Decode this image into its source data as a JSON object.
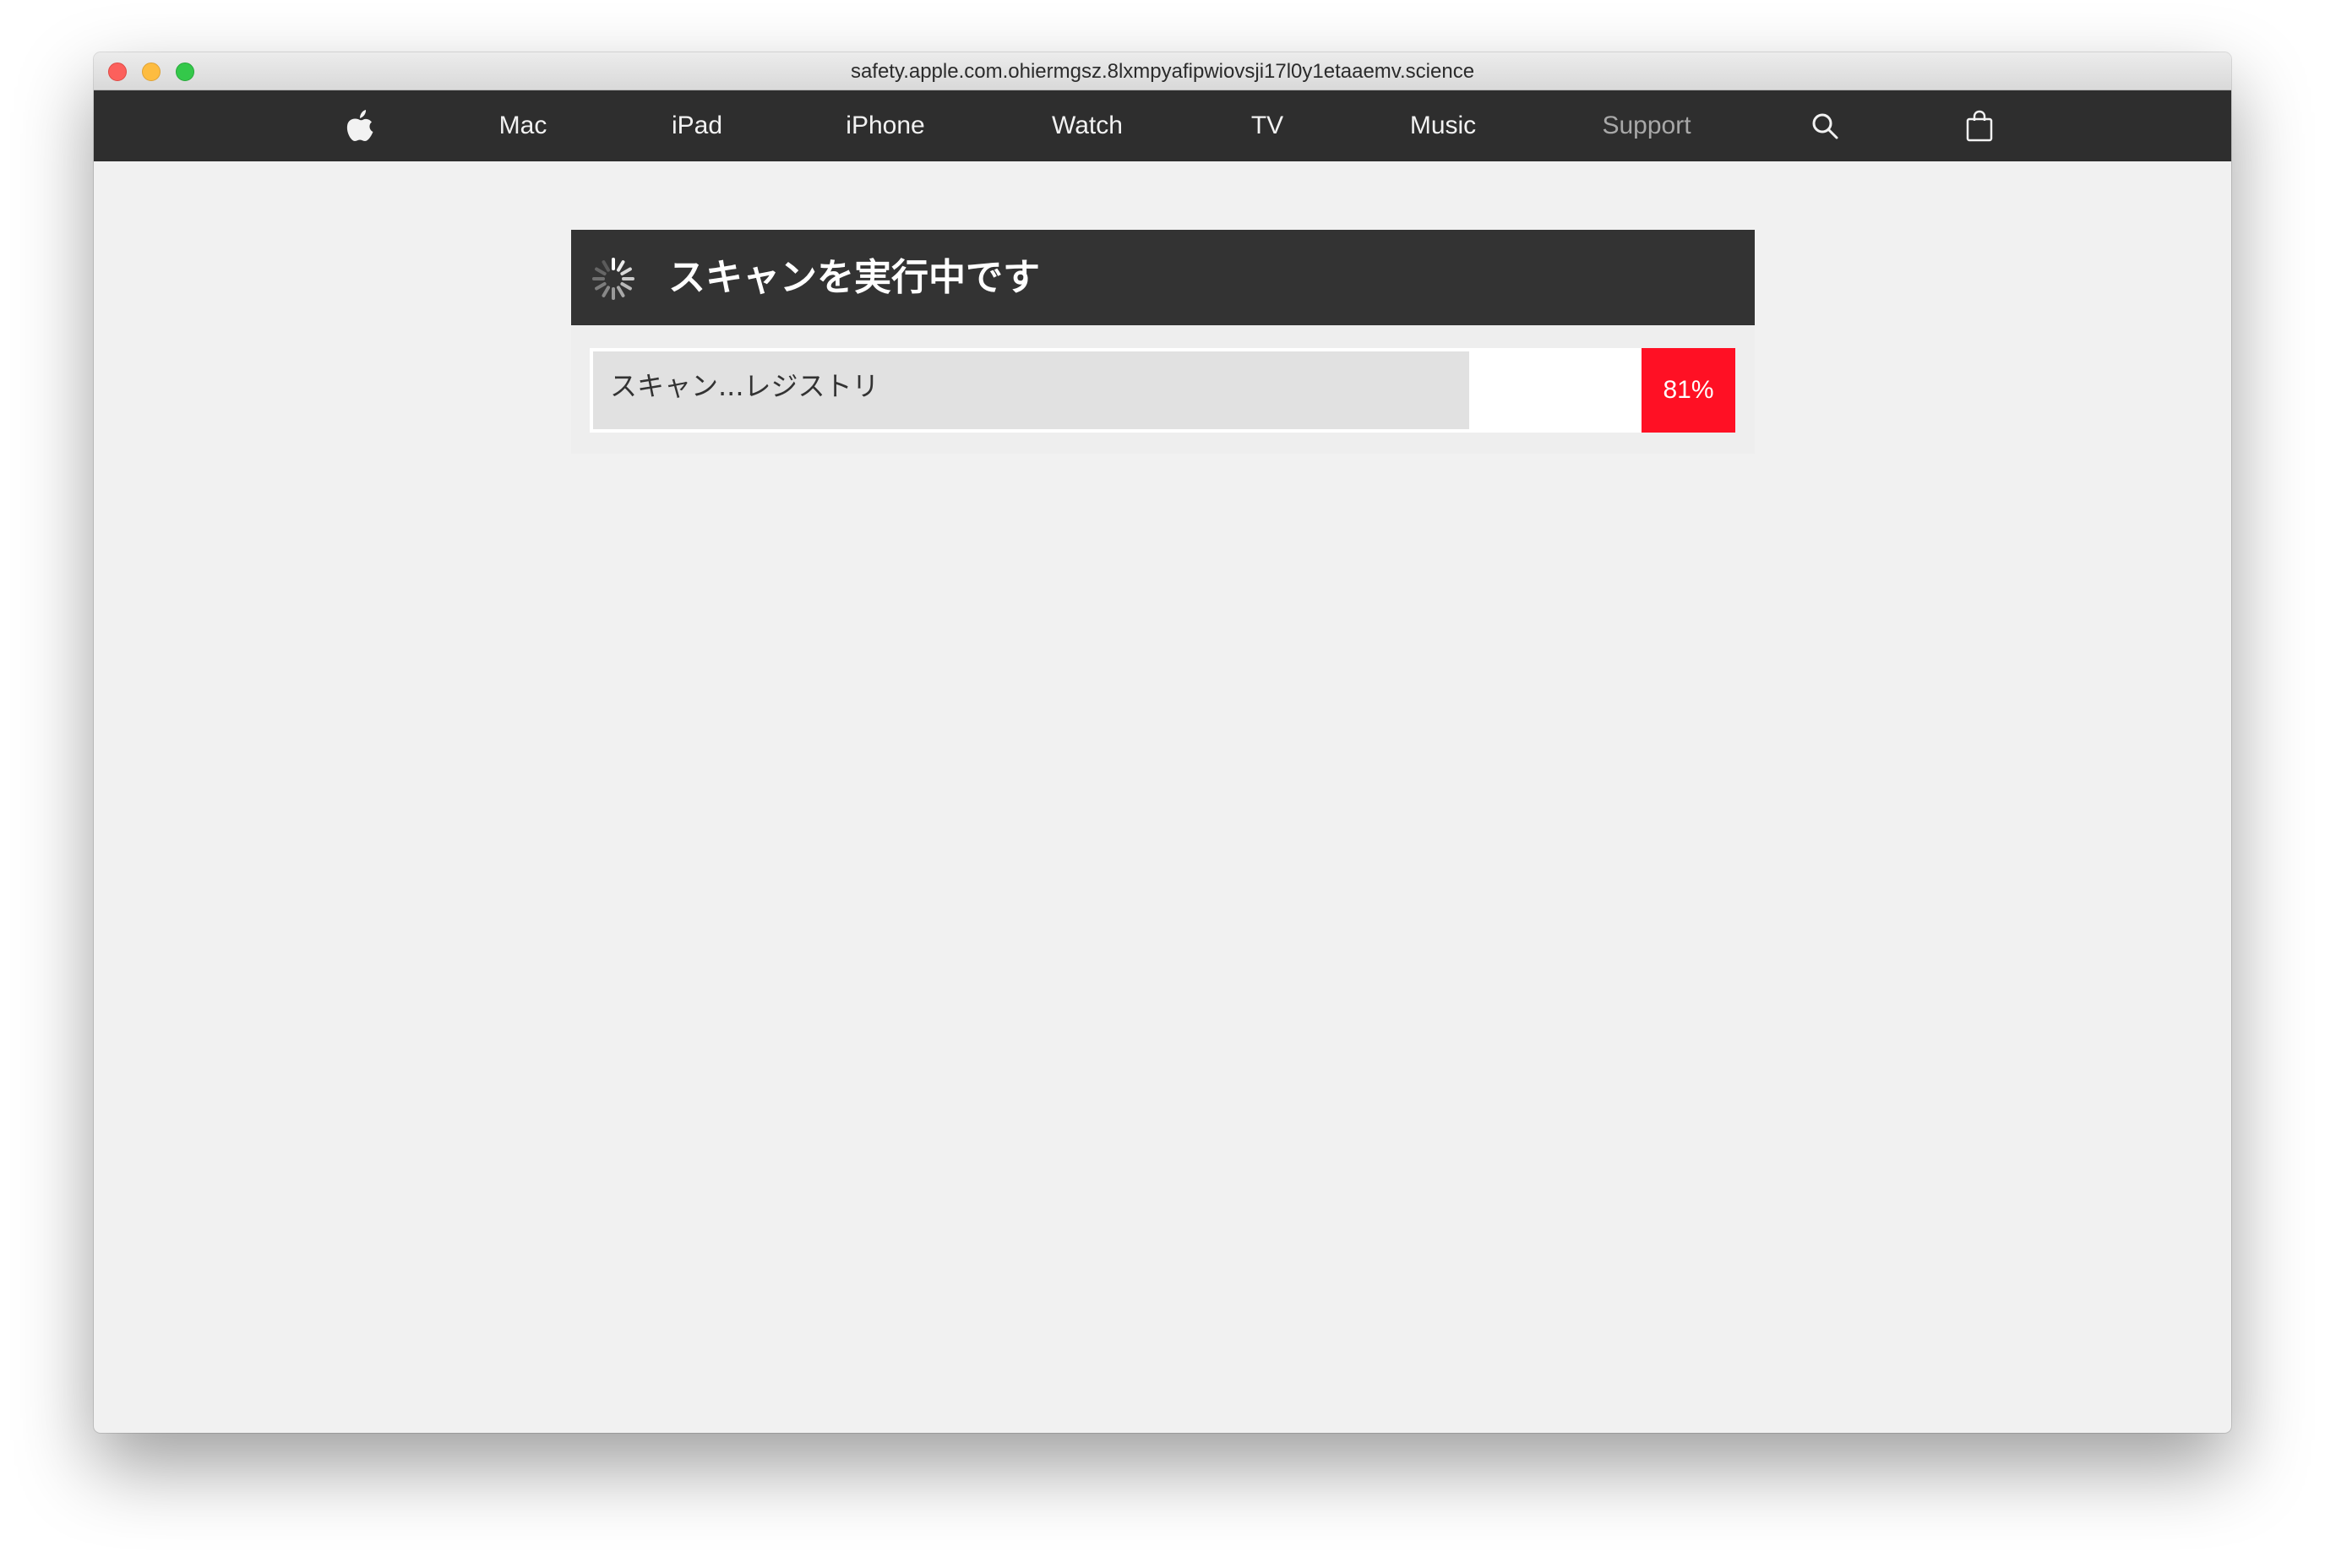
{
  "window": {
    "url": "safety.apple.com.ohiermgsz.8lxmpyafipwiovsji17l0y1etaaemv.science"
  },
  "nav": {
    "logo_icon": "apple-logo-icon",
    "items": [
      {
        "label": "Mac"
      },
      {
        "label": "iPad"
      },
      {
        "label": "iPhone"
      },
      {
        "label": "Watch"
      },
      {
        "label": "TV"
      },
      {
        "label": "Music"
      },
      {
        "label": "Support"
      }
    ],
    "search_icon": "search-icon",
    "bag_icon": "shopping-bag-icon"
  },
  "scan": {
    "title": "スキャンを実行中です",
    "spinner_icon": "spinner-icon",
    "status_text": "スキャン...レジストリ",
    "progress_percent": 81,
    "progress_label": "81%"
  },
  "colors": {
    "nav_background": "#2e2e2e",
    "header_background": "#333333",
    "page_background": "#f1f1f1",
    "accent_red": "#ff1024"
  }
}
